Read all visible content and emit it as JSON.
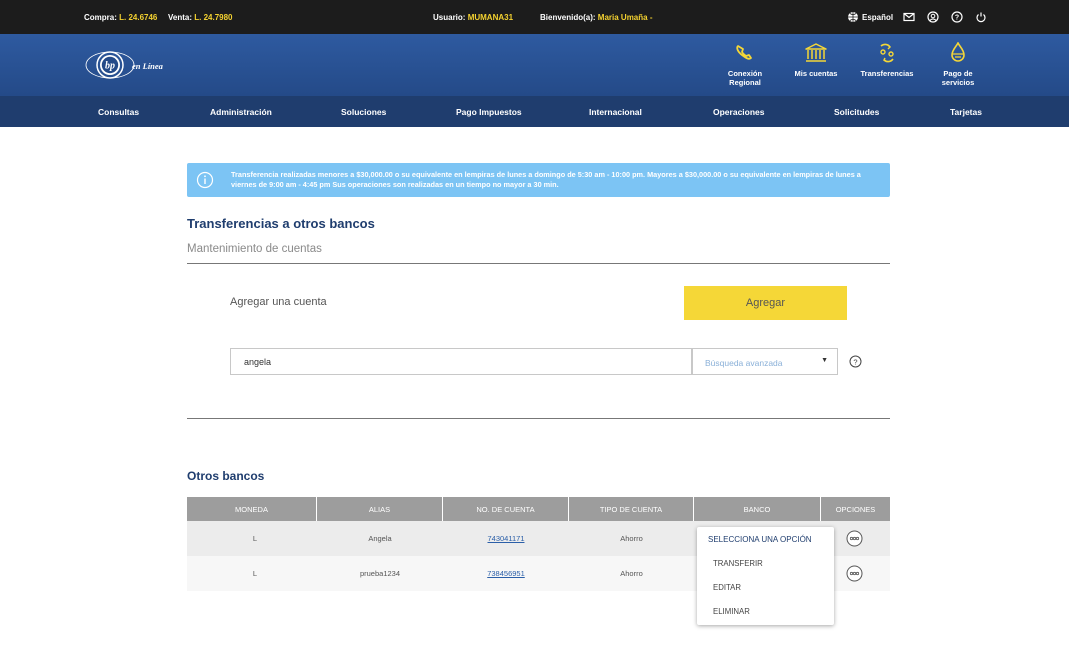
{
  "topbar": {
    "buy_label": "Compra:",
    "buy_value": "L. 24.6746",
    "sell_label": "Venta:",
    "sell_value": "L. 24.7980",
    "user_label": "Usuario:",
    "user_value": "MUMANA31",
    "welcome_label": "Bienvenido(a):",
    "welcome_value": "Maria Umaña -",
    "language": "Español"
  },
  "header": {
    "logo_text": "en Línea",
    "logo_initials": "bp",
    "nav": [
      {
        "label_line1": "Conexión",
        "label_line2": "Regional",
        "icon": "phone-icon"
      },
      {
        "label_line1": "Mis cuentas",
        "label_line2": "",
        "icon": "bank-icon"
      },
      {
        "label_line1": "Transferencias",
        "label_line2": "",
        "icon": "transfer-icon"
      },
      {
        "label_line1": "Pago de",
        "label_line2": "servicios",
        "icon": "bill-icon"
      }
    ]
  },
  "menu": [
    "Consultas",
    "Administración",
    "Soluciones",
    "Pago Impuestos",
    "Internacional",
    "Operaciones",
    "Solicitudes",
    "Tarjetas"
  ],
  "banner": {
    "text": "Transferencia realizadas menores a $30,000.00 o su equivalente en lempiras de lunes a domingo de 5:30 am - 10:00 pm. Mayores a $30,000.00 o su equivalente en lempiras de lunes a viernes de 9:00 am - 4:45 pm Sus operaciones son realizadas en un tiempo no mayor a 30 min."
  },
  "page": {
    "title": "Transferencias a otros bancos",
    "subtitle": "Mantenimiento de cuentas",
    "add_label": "Agregar una cuenta",
    "add_button": "Agregar",
    "search_value": "angela",
    "advanced_search": "Búsqueda avanzada",
    "section_title": "Otros bancos"
  },
  "table": {
    "headers": [
      "MONEDA",
      "ALIAS",
      "NO. DE CUENTA",
      "TIPO DE CUENTA",
      "BANCO",
      "OPCIONES"
    ],
    "rows": [
      {
        "moneda": "L",
        "alias": "Angela",
        "cuenta": "743041171",
        "tipo": "Ahorro",
        "banco": ""
      },
      {
        "moneda": "L",
        "alias": "prueba1234",
        "cuenta": "738456951",
        "tipo": "Ahorro",
        "banco": ""
      }
    ]
  },
  "dropdown": {
    "header": "SELECCIONA UNA OPCIÓN",
    "items": [
      "TRANSFERIR",
      "EDITAR",
      "ELIMINAR"
    ]
  },
  "colors": {
    "accent_yellow": "#f5d737",
    "header_blue": "#2e5aa0",
    "menu_blue": "#1f3d6e",
    "banner_blue": "#7cc4f4"
  }
}
